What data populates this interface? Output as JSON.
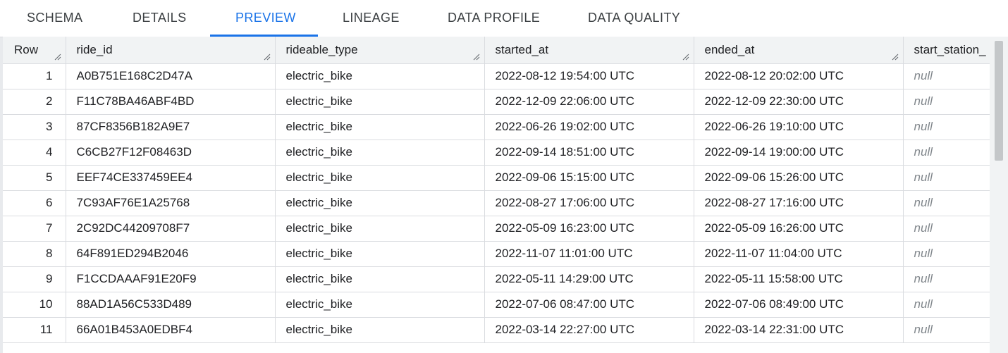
{
  "tabs": [
    {
      "label": "SCHEMA",
      "active": false
    },
    {
      "label": "DETAILS",
      "active": false
    },
    {
      "label": "PREVIEW",
      "active": true
    },
    {
      "label": "LINEAGE",
      "active": false
    },
    {
      "label": "DATA PROFILE",
      "active": false
    },
    {
      "label": "DATA QUALITY",
      "active": false
    }
  ],
  "colors": {
    "accent": "#1a73e8",
    "header_bg": "#f1f3f4",
    "null_text": "#80868b"
  },
  "table": {
    "columns": [
      "Row",
      "ride_id",
      "rideable_type",
      "started_at",
      "ended_at",
      "start_station_"
    ],
    "rows": [
      [
        "1",
        "A0B751E168C2D47A",
        "electric_bike",
        "2022-08-12 19:54:00 UTC",
        "2022-08-12 20:02:00 UTC",
        "null"
      ],
      [
        "2",
        "F11C78BA46ABF4BD",
        "electric_bike",
        "2022-12-09 22:06:00 UTC",
        "2022-12-09 22:30:00 UTC",
        "null"
      ],
      [
        "3",
        "87CF8356B182A9E7",
        "electric_bike",
        "2022-06-26 19:02:00 UTC",
        "2022-06-26 19:10:00 UTC",
        "null"
      ],
      [
        "4",
        "C6CB27F12F08463D",
        "electric_bike",
        "2022-09-14 18:51:00 UTC",
        "2022-09-14 19:00:00 UTC",
        "null"
      ],
      [
        "5",
        "EEF74CE337459EE4",
        "electric_bike",
        "2022-09-06 15:15:00 UTC",
        "2022-09-06 15:26:00 UTC",
        "null"
      ],
      [
        "6",
        "7C93AF76E1A25768",
        "electric_bike",
        "2022-08-27 17:06:00 UTC",
        "2022-08-27 17:16:00 UTC",
        "null"
      ],
      [
        "7",
        "2C92DC44209708F7",
        "electric_bike",
        "2022-05-09 16:23:00 UTC",
        "2022-05-09 16:26:00 UTC",
        "null"
      ],
      [
        "8",
        "64F891ED294B2046",
        "electric_bike",
        "2022-11-07 11:01:00 UTC",
        "2022-11-07 11:04:00 UTC",
        "null"
      ],
      [
        "9",
        "F1CCDAAAF91E20F9",
        "electric_bike",
        "2022-05-11 14:29:00 UTC",
        "2022-05-11 15:58:00 UTC",
        "null"
      ],
      [
        "10",
        "88AD1A56C533D489",
        "electric_bike",
        "2022-07-06 08:47:00 UTC",
        "2022-07-06 08:49:00 UTC",
        "null"
      ],
      [
        "11",
        "66A01B453A0EDBF4",
        "electric_bike",
        "2022-03-14 22:27:00 UTC",
        "2022-03-14 22:31:00 UTC",
        "null"
      ]
    ]
  }
}
